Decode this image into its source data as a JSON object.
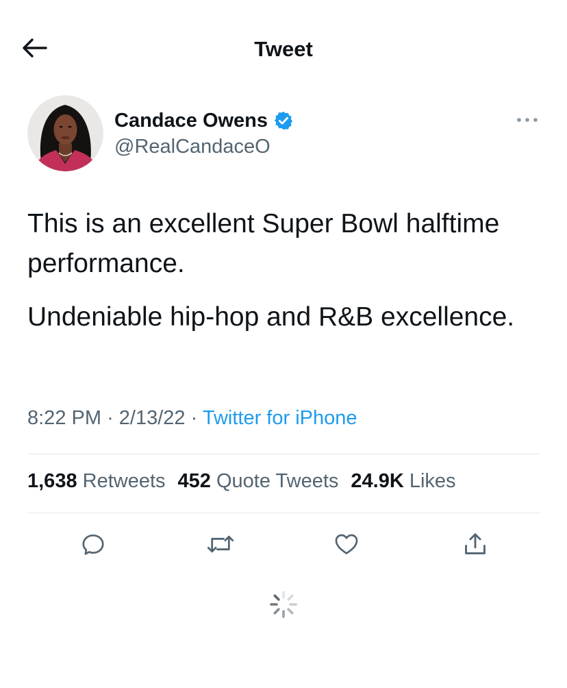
{
  "header": {
    "title": "Tweet"
  },
  "author": {
    "name": "Candace Owens",
    "handle": "@RealCandaceO",
    "verified": true
  },
  "tweet": {
    "paragraphs": [
      "This is an excellent Super Bowl halftime performance.",
      "Undeniable hip-hop and R&B excellence."
    ],
    "time": "8:22 PM",
    "date": "2/13/22",
    "separator": "·",
    "source": "Twitter for iPhone"
  },
  "stats": {
    "retweets_count": "1,638",
    "retweets_label": "Retweets",
    "quotes_count": "452",
    "quotes_label": "Quote Tweets",
    "likes_count": "24.9K",
    "likes_label": "Likes"
  },
  "icons": {
    "back": "arrow-left-icon",
    "verified": "verified-badge-icon",
    "more": "more-horizontal-icon",
    "reply": "reply-icon",
    "retweet": "retweet-icon",
    "like": "heart-icon",
    "share": "share-icon",
    "loading": "loading-spinner-icon"
  },
  "colors": {
    "accent": "#1d9bf0",
    "text_primary": "#0f1419",
    "text_secondary": "#536471",
    "divider": "#e5e8eb"
  }
}
